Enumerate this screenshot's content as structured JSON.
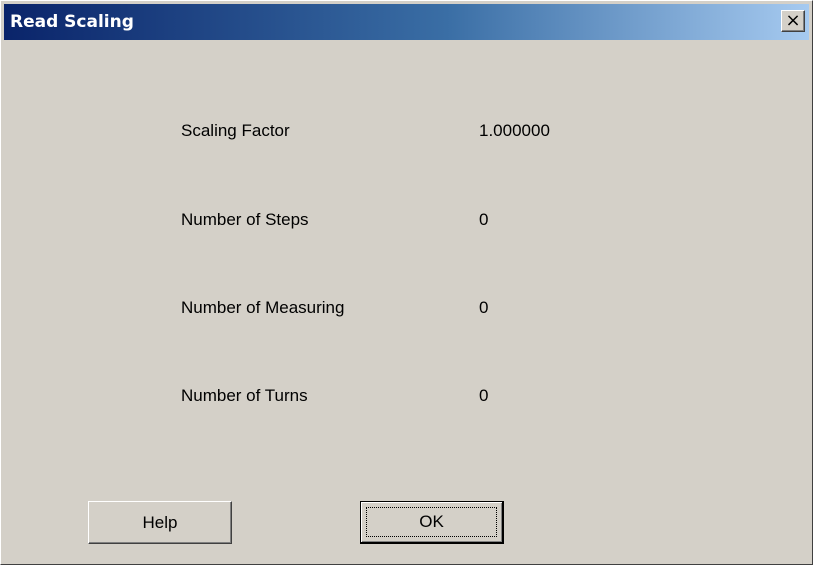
{
  "window": {
    "title": "Read Scaling",
    "close_label": "×"
  },
  "rows": [
    {
      "label": "Scaling Factor",
      "value": "1.000000"
    },
    {
      "label": "Number of Steps",
      "value": "0"
    },
    {
      "label": "Number of Measuring",
      "value": "0"
    },
    {
      "label": "Number of Turns",
      "value": "0"
    }
  ],
  "buttons": {
    "help_label": "Help",
    "ok_label": "OK"
  }
}
